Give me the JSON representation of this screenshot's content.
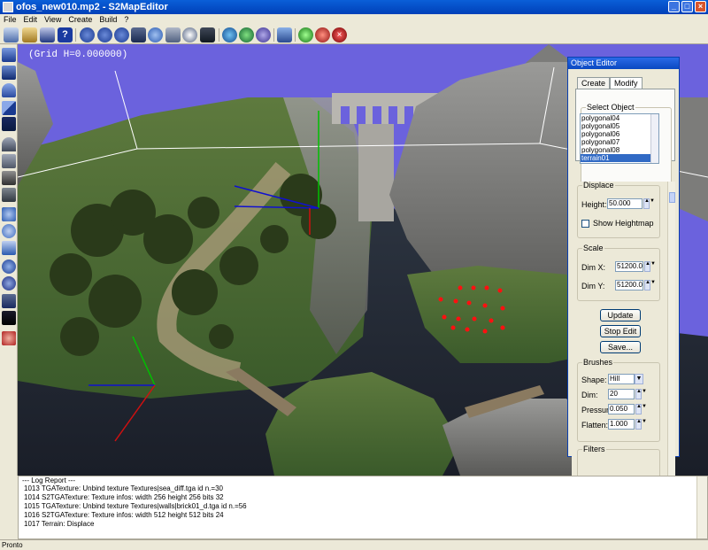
{
  "window": {
    "title": "ofos_new010.mp2 - S2MapEditor",
    "btn_min": "_",
    "btn_max": "□",
    "btn_close": "×"
  },
  "menu": [
    "File",
    "Edit",
    "View",
    "Create",
    "Build",
    "?"
  ],
  "toolbar": {
    "icons": [
      "new-icon",
      "open-icon",
      "save-icon",
      "help-icon",
      "tool-a-icon",
      "tool-b-icon",
      "tool-c-icon",
      "tool-d-icon",
      "rotate-view-icon",
      "move-view-icon",
      "zoom-icon",
      "render-icon",
      "globe-icon",
      "sphere-icon",
      "texture-sphere-icon",
      "network-icon",
      "green-light-icon",
      "red-light-icon",
      "stop-icon"
    ]
  },
  "left_toolbar": {
    "icons": [
      "box-icon",
      "box-shaded-icon",
      "pipe-icon",
      "wedge-icon",
      "plane-icon",
      "arch-icon",
      "group-icon",
      "group-b-icon",
      "object-icon",
      "clone-icon",
      "move-icon",
      "rotate-icon",
      "scale-icon",
      "globe-tool-icon",
      "user-icon",
      "mesh-icon",
      "camera-icon",
      "light-icon"
    ]
  },
  "viewport": {
    "grid_label": "(Grid H=0.000000)"
  },
  "object_editor": {
    "title": "Object Editor",
    "tabs": [
      "Create",
      "Modify"
    ],
    "active_tab": "Modify",
    "select_object": {
      "legend": "Select Object",
      "items": [
        "polygonal04",
        "polygonal05",
        "polygonal06",
        "polygonal07",
        "polygonal08",
        "terrain01"
      ],
      "selected": "terrain01"
    },
    "displace": {
      "legend": "Displace",
      "height_label": "Height:",
      "height_value": "50.000",
      "show_heightmap_label": "Show Heightmap"
    },
    "scale": {
      "legend": "Scale",
      "dimx_label": "Dim X:",
      "dimx_value": "51200.0",
      "dimy_label": "Dim Y:",
      "dimy_value": "51200.0"
    },
    "buttons": {
      "update": "Update",
      "stop_edit": "Stop Edit",
      "save": "Save..."
    },
    "brushes": {
      "legend": "Brushes",
      "shape_label": "Shape:",
      "shape_value": "Hill",
      "dim_label": "Dim:",
      "dim_value": "20",
      "pressure_label": "Pressure:",
      "pressure_value": "0.050",
      "flatten_label": "Flatten:",
      "flatten_value": "1.000"
    },
    "filters_legend": "Filters"
  },
  "log": {
    "header": "--- Log Report ---",
    "lines": [
      "1013 TGATexture: Unbind texture Textures|sea_diff.tga id n.=30",
      "1014 S2TGATexture: Texture infos: width 256 height 256 bits 32",
      "1015 TGATexture: Unbind texture Textures|walls|brick01_d.tga id n.=56",
      "1016 S2TGATexture: Texture infos: width 512 height 512 bits 24",
      "1017 Terrain: Displace"
    ]
  },
  "status": {
    "text": "Pronto"
  }
}
